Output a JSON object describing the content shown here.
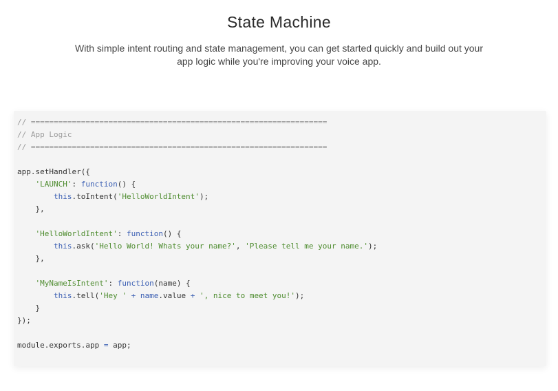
{
  "section": {
    "title": "State Machine",
    "description": "With simple intent routing and state management, you can get started quickly and build out your app logic while you're improving your voice app."
  },
  "code": {
    "language": "javascript",
    "colors": {
      "background": "#f4f4f4",
      "comment": "#9a9a9a",
      "string": "#4e8c2f",
      "keyword": "#3b5fb3",
      "plain": "#333333"
    },
    "lines": [
      [
        {
          "t": "comment",
          "v": "// ================================================================="
        }
      ],
      [
        {
          "t": "comment",
          "v": "// App Logic"
        }
      ],
      [
        {
          "t": "comment",
          "v": "// ================================================================="
        }
      ],
      [],
      [
        {
          "t": "plain",
          "v": "app.setHandler({"
        }
      ],
      [
        {
          "t": "plain",
          "v": "    "
        },
        {
          "t": "string",
          "v": "'LAUNCH'"
        },
        {
          "t": "plain",
          "v": ": "
        },
        {
          "t": "keyword",
          "v": "function"
        },
        {
          "t": "plain",
          "v": "() {"
        }
      ],
      [
        {
          "t": "plain",
          "v": "        "
        },
        {
          "t": "keyword",
          "v": "this"
        },
        {
          "t": "plain",
          "v": ".toIntent("
        },
        {
          "t": "string",
          "v": "'HelloWorldIntent'"
        },
        {
          "t": "plain",
          "v": ");"
        }
      ],
      [
        {
          "t": "plain",
          "v": "    },"
        }
      ],
      [],
      [
        {
          "t": "plain",
          "v": "    "
        },
        {
          "t": "string",
          "v": "'HelloWorldIntent'"
        },
        {
          "t": "plain",
          "v": ": "
        },
        {
          "t": "keyword",
          "v": "function"
        },
        {
          "t": "plain",
          "v": "() {"
        }
      ],
      [
        {
          "t": "plain",
          "v": "        "
        },
        {
          "t": "keyword",
          "v": "this"
        },
        {
          "t": "plain",
          "v": ".ask("
        },
        {
          "t": "string",
          "v": "'Hello World! Whats your name?'"
        },
        {
          "t": "plain",
          "v": ", "
        },
        {
          "t": "string",
          "v": "'Please tell me your name.'"
        },
        {
          "t": "plain",
          "v": ");"
        }
      ],
      [
        {
          "t": "plain",
          "v": "    },"
        }
      ],
      [],
      [
        {
          "t": "plain",
          "v": "    "
        },
        {
          "t": "string",
          "v": "'MyNameIsIntent'"
        },
        {
          "t": "plain",
          "v": ": "
        },
        {
          "t": "keyword",
          "v": "function"
        },
        {
          "t": "plain",
          "v": "(name) {"
        }
      ],
      [
        {
          "t": "plain",
          "v": "        "
        },
        {
          "t": "keyword",
          "v": "this"
        },
        {
          "t": "plain",
          "v": ".tell("
        },
        {
          "t": "string",
          "v": "'Hey '"
        },
        {
          "t": "plain",
          "v": " "
        },
        {
          "t": "keyword",
          "v": "+"
        },
        {
          "t": "plain",
          "v": " "
        },
        {
          "t": "keyword",
          "v": "name"
        },
        {
          "t": "plain",
          "v": ".value "
        },
        {
          "t": "keyword",
          "v": "+"
        },
        {
          "t": "plain",
          "v": " "
        },
        {
          "t": "string",
          "v": "', nice to meet you!'"
        },
        {
          "t": "plain",
          "v": ");"
        }
      ],
      [
        {
          "t": "plain",
          "v": "    }"
        }
      ],
      [
        {
          "t": "plain",
          "v": "});"
        }
      ],
      [],
      [
        {
          "t": "plain",
          "v": "module.exports.app "
        },
        {
          "t": "keyword",
          "v": "="
        },
        {
          "t": "plain",
          "v": " app;"
        }
      ]
    ]
  }
}
